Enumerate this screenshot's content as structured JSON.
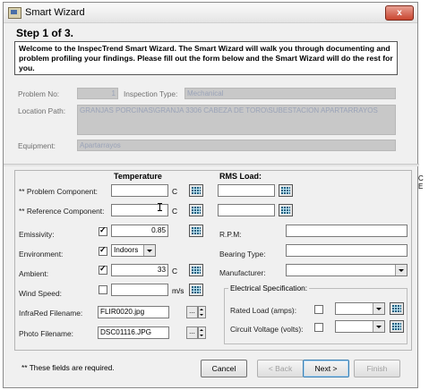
{
  "window": {
    "title": "Smart Wizard",
    "close_glyph": "x"
  },
  "header": {
    "step": "Step 1 of 3.",
    "welcome": "Welcome to the InspecTrend Smart Wizard. The Smart Wizard will walk you through documenting and problem profiling your findings. Please fill out the form below and the Smart Wizard will do the rest for you.",
    "problem_no_label": "Problem No:",
    "problem_no_value": "1",
    "inspection_type_label": "Inspection Type:",
    "inspection_type_value": "Mechanical",
    "location_path_label": "Location Path:",
    "location_path_value": "GRANJAS PORCINAS\\GRANJA 3306 CABEZA DE TORO\\SUBESTACION APARTARRAYOS",
    "equipment_label": "Equipment:",
    "equipment_value": "Apartarrayos"
  },
  "form": {
    "temperature_header": "Temperature",
    "rms_header": "RMS Load:",
    "problem_component_label": "** Problem Component:",
    "reference_component_label": "** Reference Component:",
    "emissivity_label": "Emissivity:",
    "emissivity_value": "0.85",
    "environment_label": "Environment:",
    "environment_value": "Indoors",
    "ambient_label": "Ambient:",
    "ambient_value": "33",
    "wind_speed_label": "Wind Speed:",
    "wind_unit": "m/s",
    "temp_unit": "C",
    "infrared_filename_label": "InfraRed Filename:",
    "infrared_filename_value": "FLIR0020.jpg",
    "photo_filename_label": "Photo Filename:",
    "photo_filename_value": "DSC01116.JPG",
    "browse_label": "...",
    "rpm_label": "R.P.M:",
    "bearing_type_label": "Bearing Type:",
    "manufacturer_label": "Manufacturer:",
    "electrical_group_title": "Electrical Specification:",
    "rated_load_label": "Rated Load (amps):",
    "circuit_voltage_label": "Circuit Voltage (volts):"
  },
  "footer": {
    "required_note": "** These fields are required.",
    "cancel": "Cancel",
    "back": "< Back",
    "next": "Next >",
    "finish": "Finish"
  },
  "background_text": "C E"
}
